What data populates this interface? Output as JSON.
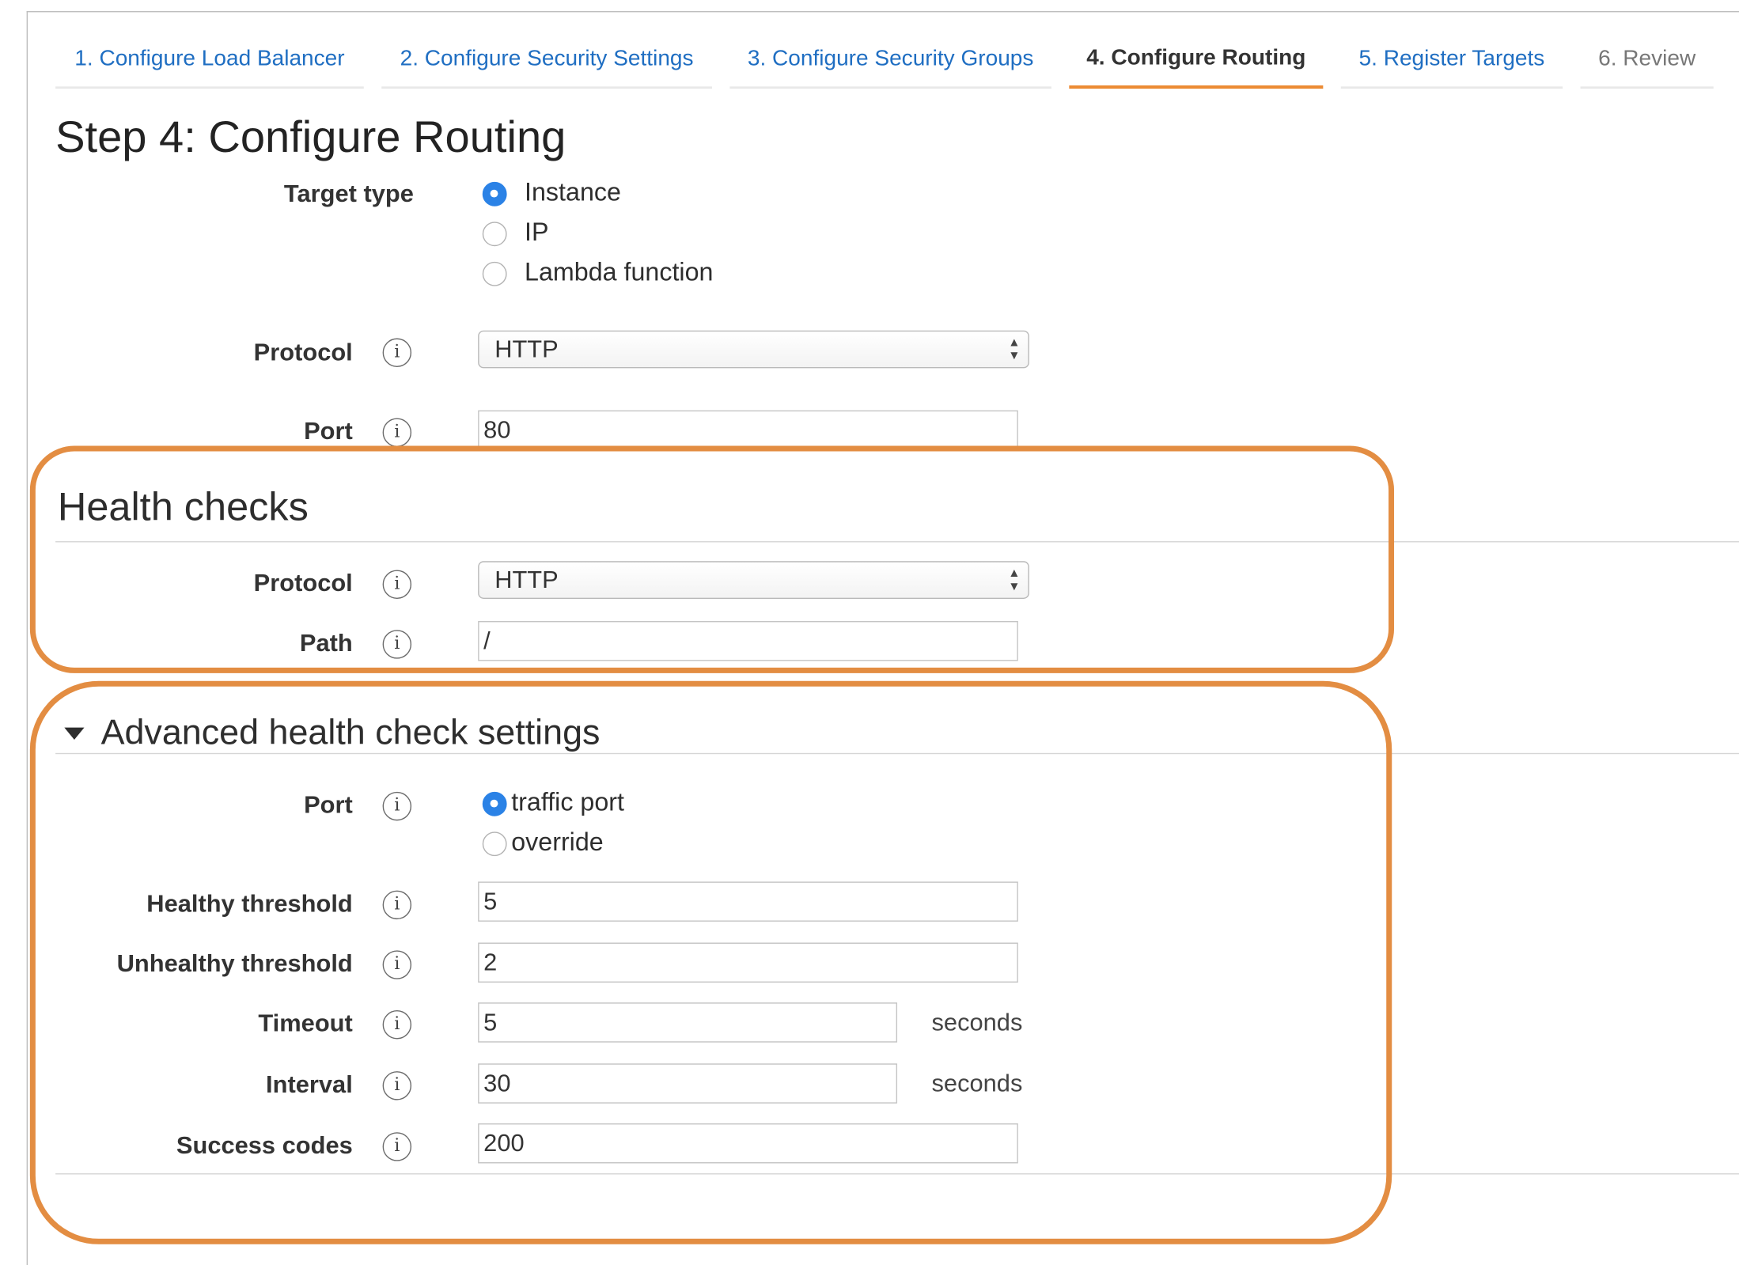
{
  "tabs": [
    {
      "label": "1. Configure Load Balancer"
    },
    {
      "label": "2. Configure Security Settings"
    },
    {
      "label": "3. Configure Security Groups"
    },
    {
      "label": "4. Configure Routing"
    },
    {
      "label": "5. Register Targets"
    },
    {
      "label": "6. Review"
    }
  ],
  "page_title": "Step 4: Configure Routing",
  "routing": {
    "target_type_label": "Target type",
    "target_options": [
      {
        "label": "Instance",
        "selected": true
      },
      {
        "label": "IP",
        "selected": false
      },
      {
        "label": "Lambda function",
        "selected": false
      }
    ],
    "protocol_label": "Protocol",
    "protocol_value": "HTTP",
    "port_label": "Port",
    "port_value": "80"
  },
  "health_checks": {
    "heading": "Health checks",
    "protocol_label": "Protocol",
    "protocol_value": "HTTP",
    "path_label": "Path",
    "path_value": "/"
  },
  "advanced": {
    "heading": "Advanced health check settings",
    "port_label": "Port",
    "port_options": [
      {
        "label": "traffic port",
        "selected": true
      },
      {
        "label": "override",
        "selected": false
      }
    ],
    "healthy_label": "Healthy threshold",
    "healthy_value": "5",
    "unhealthy_label": "Unhealthy threshold",
    "unhealthy_value": "2",
    "timeout_label": "Timeout",
    "timeout_value": "5",
    "timeout_unit": "seconds",
    "interval_label": "Interval",
    "interval_value": "30",
    "interval_unit": "seconds",
    "success_label": "Success codes",
    "success_value": "200"
  },
  "icons": {
    "info": "i",
    "select_arrows": "▲▼"
  },
  "colors": {
    "accent_orange": "#e38d42",
    "link_blue": "#1f6ec2",
    "radio_blue": "#2b82e6"
  }
}
